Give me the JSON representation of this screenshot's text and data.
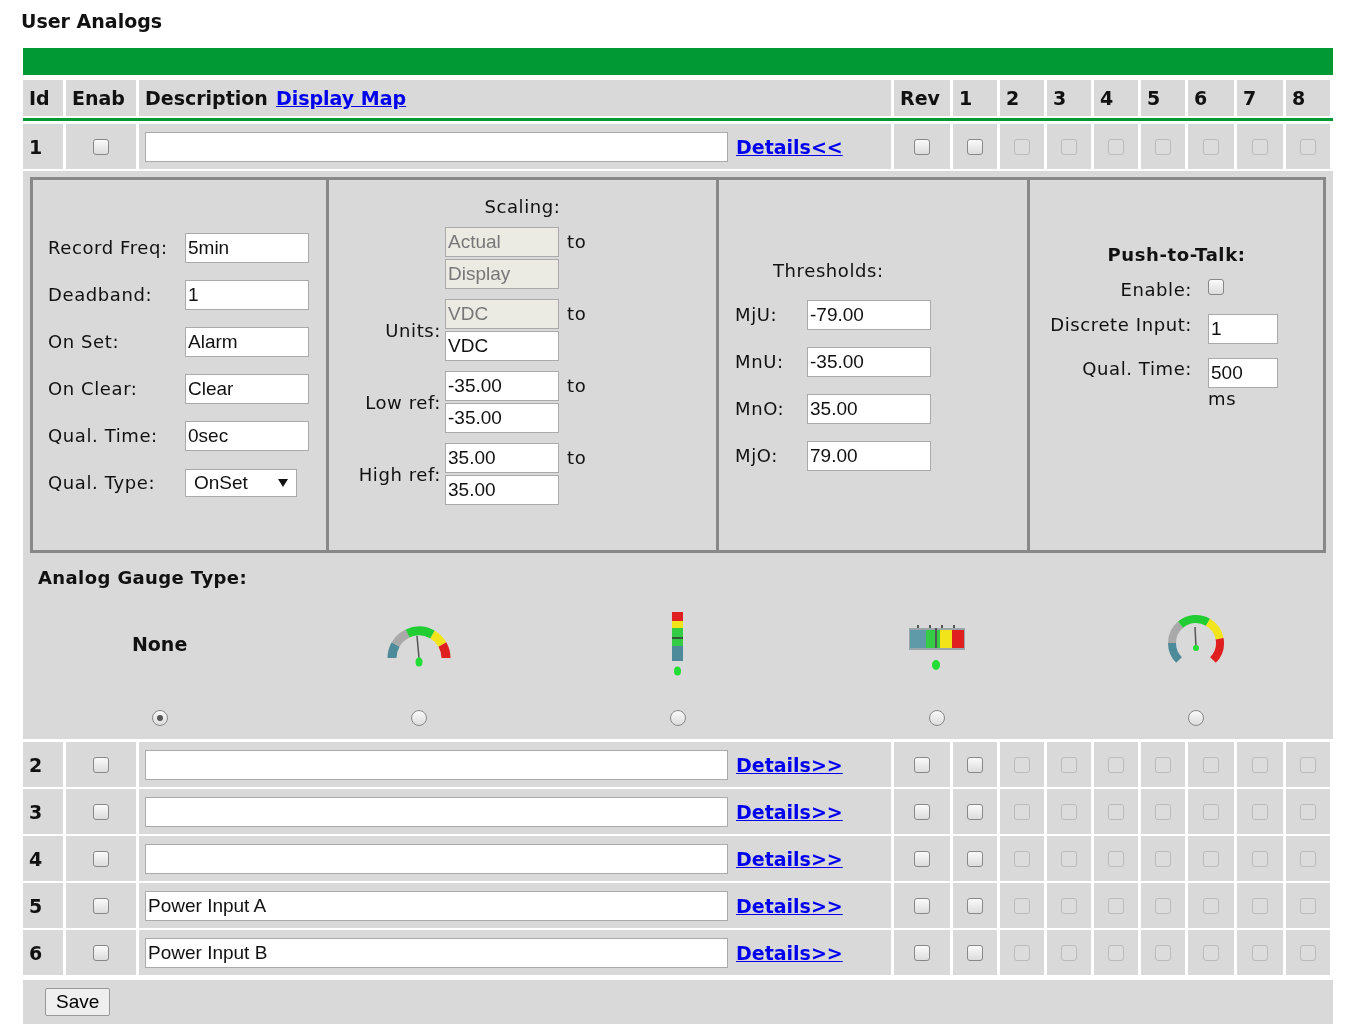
{
  "title": "User Analogs",
  "header": {
    "id": "Id",
    "enab": "Enab",
    "description": "Description",
    "display_map": "Display Map",
    "rev": "Rev",
    "outputs": [
      "1",
      "2",
      "3",
      "4",
      "5",
      "6",
      "7",
      "8"
    ]
  },
  "rows": [
    {
      "id": "1",
      "enabled": false,
      "details": "Details<<",
      "expanded": true,
      "rev": false,
      "outputs": [
        {
          "checked": false,
          "disabled": false
        },
        {
          "checked": false,
          "disabled": true
        },
        {
          "checked": false,
          "disabled": true
        },
        {
          "checked": false,
          "disabled": true
        },
        {
          "checked": false,
          "disabled": true
        },
        {
          "checked": false,
          "disabled": true
        },
        {
          "checked": false,
          "disabled": true
        },
        {
          "checked": false,
          "disabled": true
        }
      ]
    },
    {
      "id": "2",
      "enabled": false,
      "details": "Details>>",
      "expanded": false,
      "rev": false,
      "outputs": [
        {
          "checked": false,
          "disabled": false
        },
        {
          "checked": false,
          "disabled": true
        },
        {
          "checked": false,
          "disabled": true
        },
        {
          "checked": false,
          "disabled": true
        },
        {
          "checked": false,
          "disabled": true
        },
        {
          "checked": false,
          "disabled": true
        },
        {
          "checked": false,
          "disabled": true
        },
        {
          "checked": false,
          "disabled": true
        }
      ]
    },
    {
      "id": "3",
      "enabled": false,
      "details": "Details>>",
      "expanded": false,
      "rev": false,
      "outputs": [
        {
          "checked": false,
          "disabled": false
        },
        {
          "checked": false,
          "disabled": true
        },
        {
          "checked": false,
          "disabled": true
        },
        {
          "checked": false,
          "disabled": true
        },
        {
          "checked": false,
          "disabled": true
        },
        {
          "checked": false,
          "disabled": true
        },
        {
          "checked": false,
          "disabled": true
        },
        {
          "checked": false,
          "disabled": true
        }
      ]
    },
    {
      "id": "4",
      "enabled": false,
      "details": "Details>>",
      "expanded": false,
      "rev": false,
      "outputs": [
        {
          "checked": false,
          "disabled": false
        },
        {
          "checked": false,
          "disabled": true
        },
        {
          "checked": false,
          "disabled": true
        },
        {
          "checked": false,
          "disabled": true
        },
        {
          "checked": false,
          "disabled": true
        },
        {
          "checked": false,
          "disabled": true
        },
        {
          "checked": false,
          "disabled": true
        },
        {
          "checked": false,
          "disabled": true
        }
      ]
    },
    {
      "id": "5",
      "enabled": false,
      "description": "Power Input A",
      "details": "Details>>",
      "expanded": false,
      "rev": false,
      "outputs": [
        {
          "checked": false,
          "disabled": false
        },
        {
          "checked": false,
          "disabled": true
        },
        {
          "checked": false,
          "disabled": true
        },
        {
          "checked": false,
          "disabled": true
        },
        {
          "checked": false,
          "disabled": true
        },
        {
          "checked": false,
          "disabled": true
        },
        {
          "checked": false,
          "disabled": true
        },
        {
          "checked": false,
          "disabled": true
        }
      ]
    },
    {
      "id": "6",
      "enabled": false,
      "description": "Power Input B",
      "details": "Details>>",
      "expanded": false,
      "rev": false,
      "outputs": [
        {
          "checked": false,
          "disabled": false
        },
        {
          "checked": false,
          "disabled": true
        },
        {
          "checked": false,
          "disabled": true
        },
        {
          "checked": false,
          "disabled": true
        },
        {
          "checked": false,
          "disabled": true
        },
        {
          "checked": false,
          "disabled": true
        },
        {
          "checked": false,
          "disabled": true
        },
        {
          "checked": false,
          "disabled": true
        }
      ]
    }
  ],
  "details_panel": {
    "general": [
      {
        "label": "Record Freq:",
        "kind": "text",
        "value": "5min"
      },
      {
        "label": "Deadband:",
        "kind": "text",
        "value": "1"
      },
      {
        "label": "On Set:",
        "kind": "text",
        "value": "Alarm"
      },
      {
        "label": "On Clear:",
        "kind": "text",
        "value": "Clear"
      },
      {
        "label": "Qual. Time:",
        "kind": "text",
        "value": "0sec"
      },
      {
        "label": "Qual. Type:",
        "kind": "select",
        "value": "OnSet"
      }
    ],
    "scaling": {
      "title": "Scaling:",
      "rows": [
        {
          "joiner": "to",
          "fields": [
            {
              "value": "Actual",
              "disabled": true
            },
            {
              "value": "Display",
              "disabled": true
            }
          ]
        },
        {
          "label": "Units:",
          "joiner": "to",
          "fields": [
            {
              "value": "VDC",
              "disabled": true
            },
            {
              "value": "VDC",
              "disabled": false
            }
          ]
        },
        {
          "label": "Low ref:",
          "joiner": "to",
          "fields": [
            {
              "value": "-35.00",
              "disabled": false
            },
            {
              "value": "-35.00",
              "disabled": false
            }
          ]
        },
        {
          "label": "High ref:",
          "joiner": "to",
          "fields": [
            {
              "value": "35.00",
              "disabled": false
            },
            {
              "value": "35.00",
              "disabled": false
            }
          ]
        }
      ]
    },
    "thresholds": {
      "title": "Thresholds:",
      "rows": [
        {
          "label": "MjU:",
          "value": "-79.00"
        },
        {
          "label": "MnU:",
          "value": "-35.00"
        },
        {
          "label": "MnO:",
          "value": "35.00"
        },
        {
          "label": "MjO:",
          "value": "79.00"
        }
      ]
    },
    "push_to_talk": {
      "title": "Push-to-Talk:",
      "enable_label": "Enable:",
      "enable": false,
      "rows": [
        {
          "label": "Discrete Input:",
          "value": "1"
        },
        {
          "label": "Qual. Time:",
          "value": "500",
          "unit": "ms"
        }
      ]
    },
    "gauge": {
      "title": "Analog Gauge Type:",
      "options": [
        {
          "kind": "none",
          "label": "None",
          "selected": true
        },
        {
          "kind": "semicircle",
          "selected": false
        },
        {
          "kind": "vertical",
          "selected": false
        },
        {
          "kind": "horizontal",
          "selected": false
        },
        {
          "kind": "round",
          "selected": false
        }
      ]
    }
  },
  "save": "Save"
}
